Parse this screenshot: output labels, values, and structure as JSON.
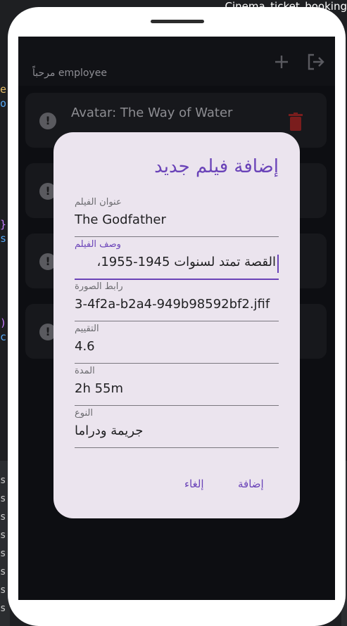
{
  "window": {
    "title": "Cinema_ticket_booking"
  },
  "app": {
    "welcome": "مرحباً employee",
    "movies": [
      {
        "title": "Avatar: The Way of Water"
      },
      {
        "title": ""
      },
      {
        "title": ""
      },
      {
        "title": ""
      }
    ]
  },
  "dialog": {
    "title": "إضافة فيلم جديد",
    "fields": [
      {
        "label": "عنوان الفيلم",
        "value": "The Godfather"
      },
      {
        "label": "وصف الفيلم",
        "value": "القصة تمتد لسنوات 1945-1955،"
      },
      {
        "label": "رابط الصورة",
        "value": "3-4f2a-b2a4-949b98592bf2.jfif"
      },
      {
        "label": "التقييم",
        "value": "4.6"
      },
      {
        "label": "المدة",
        "value": "2h 55m"
      },
      {
        "label": "النوع",
        "value": "جريمة ودراما"
      }
    ],
    "cancel_label": "إلغاء",
    "add_label": "إضافة"
  },
  "colors": {
    "accent": "#6a43b8",
    "dialog_bg": "#ebe4ee",
    "screen_bg": "#0d0e12"
  }
}
